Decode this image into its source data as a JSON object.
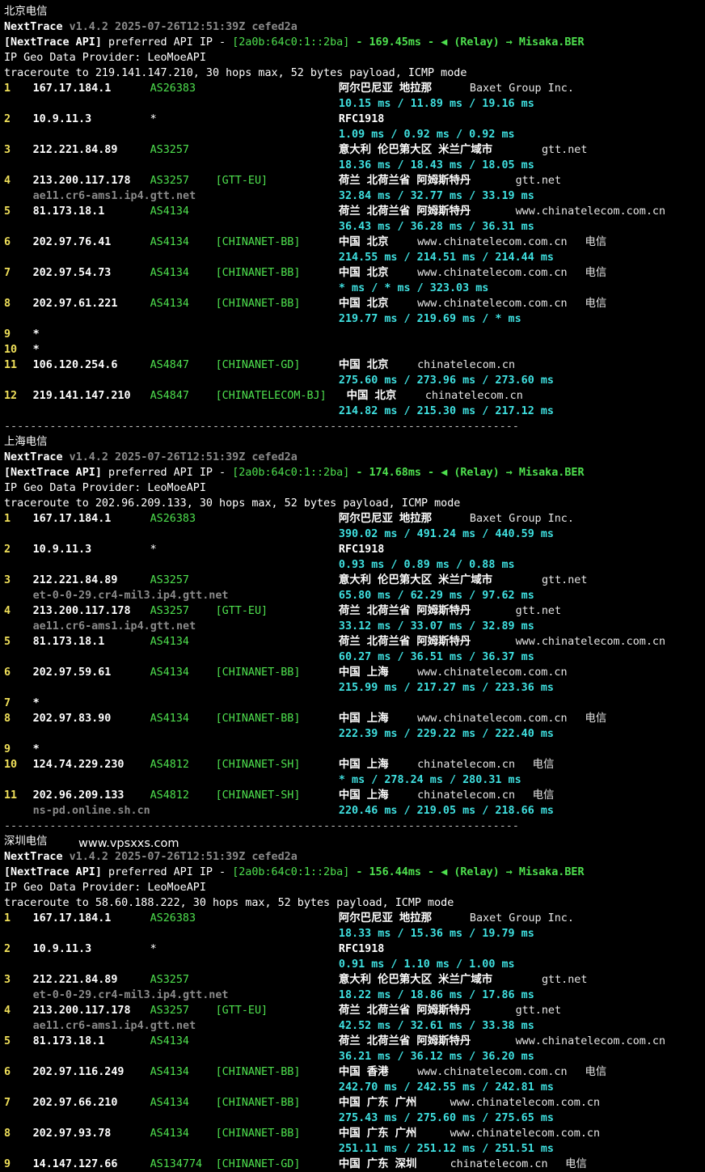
{
  "colors": {
    "background": "#000000",
    "ip": "#ffffff",
    "asn": "#4ee04e",
    "latency": "#3fe0e0",
    "hop": "#f0e05a",
    "rdns": "#8a8a8a"
  },
  "watermark": "www.vpsxxs.com",
  "separator": "-------------------------------------------------------------------------------",
  "sections": [
    {
      "title": "北京电信",
      "version_name": "NextTrace",
      "version": "v1.4.2 2025-07-26T12:51:39Z cefed2a",
      "api_prefix": "[NextTrace API]",
      "api_mid": " preferred API IP - ",
      "api_ip": "[2a0b:64c0:1::2ba]",
      "api_rest": " - 169.45ms - ",
      "api_relay": "(Relay) → Misaka.BER",
      "geo_provider": "IP Geo Data Provider: LeoMoeAPI",
      "traceroute": "traceroute to 219.141.147.210, 30 hops max, 52 bytes payload, ICMP mode",
      "hops": [
        {
          "n": "1",
          "ip": "167.17.184.1",
          "asn": "AS26383",
          "tag": "",
          "geo": "阿尔巴尼亚 地拉那",
          "org": "Baxet Group Inc.",
          "isp": "",
          "lat": "10.15 ms / 11.89 ms / 19.16 ms",
          "rdns": ""
        },
        {
          "n": "2",
          "ip": "10.9.11.3",
          "asn": "*",
          "tag": "",
          "geo": "RFC1918",
          "org": "",
          "isp": "",
          "lat": "1.09 ms / 0.92 ms / 0.92 ms",
          "rdns": ""
        },
        {
          "n": "3",
          "ip": "212.221.84.89",
          "asn": "AS3257",
          "tag": "",
          "geo": "意大利 伦巴第大区 米兰广域市",
          "org": "gtt.net",
          "isp": "",
          "lat": "18.36 ms / 18.43 ms / 18.05 ms",
          "rdns": ""
        },
        {
          "n": "4",
          "ip": "213.200.117.178",
          "asn": "AS3257",
          "tag": "[GTT-EU]",
          "geo": "荷兰 北荷兰省 阿姆斯特丹",
          "org": "gtt.net",
          "isp": "",
          "lat": "32.84 ms / 32.77 ms / 33.19 ms",
          "rdns": "ae11.cr6-ams1.ip4.gtt.net"
        },
        {
          "n": "5",
          "ip": "81.173.18.1",
          "asn": "AS4134",
          "tag": "",
          "geo": "荷兰 北荷兰省 阿姆斯特丹",
          "org": "www.chinatelecom.com.cn",
          "isp": "",
          "lat": "36.43 ms / 36.28 ms / 36.31 ms",
          "rdns": ""
        },
        {
          "n": "6",
          "ip": "202.97.76.41",
          "asn": "AS4134",
          "tag": "[CHINANET-BB]",
          "geo": "中国 北京",
          "org": "www.chinatelecom.com.cn",
          "isp": "电信",
          "lat": "214.55 ms / 214.51 ms / 214.44 ms",
          "rdns": ""
        },
        {
          "n": "7",
          "ip": "202.97.54.73",
          "asn": "AS4134",
          "tag": "[CHINANET-BB]",
          "geo": "中国 北京",
          "org": "www.chinatelecom.com.cn",
          "isp": "电信",
          "lat": "* ms / * ms / 323.03 ms",
          "rdns": ""
        },
        {
          "n": "8",
          "ip": "202.97.61.221",
          "asn": "AS4134",
          "tag": "[CHINANET-BB]",
          "geo": "中国 北京",
          "org": "www.chinatelecom.com.cn",
          "isp": "电信",
          "lat": "219.77 ms / 219.69 ms / * ms",
          "rdns": ""
        },
        {
          "n": "9",
          "ip": "*",
          "asn": "",
          "tag": "",
          "geo": "",
          "org": "",
          "isp": "",
          "lat": "",
          "rdns": ""
        },
        {
          "n": "10",
          "ip": "*",
          "asn": "",
          "tag": "",
          "geo": "",
          "org": "",
          "isp": "",
          "lat": "",
          "rdns": ""
        },
        {
          "n": "11",
          "ip": "106.120.254.6",
          "asn": "AS4847",
          "tag": "[CHINANET-GD]",
          "geo": "中国 北京",
          "org": "chinatelecom.cn",
          "isp": "",
          "lat": "275.60 ms / 273.96 ms / 273.60 ms",
          "rdns": ""
        },
        {
          "n": "12",
          "ip": "219.141.147.210",
          "asn": "AS4847",
          "tag": "[CHINATELECOM-BJ]",
          "geo": "中国 北京",
          "org": "chinatelecom.cn",
          "isp": "",
          "lat": "214.82 ms / 215.30 ms / 217.12 ms",
          "rdns": ""
        }
      ]
    },
    {
      "title": "上海电信",
      "version_name": "NextTrace",
      "version": "v1.4.2 2025-07-26T12:51:39Z cefed2a",
      "api_prefix": "[NextTrace API]",
      "api_mid": " preferred API IP - ",
      "api_ip": "[2a0b:64c0:1::2ba]",
      "api_rest": " - 174.68ms - ",
      "api_relay": "(Relay) → Misaka.BER",
      "geo_provider": "IP Geo Data Provider: LeoMoeAPI",
      "traceroute": "traceroute to 202.96.209.133, 30 hops max, 52 bytes payload, ICMP mode",
      "hops": [
        {
          "n": "1",
          "ip": "167.17.184.1",
          "asn": "AS26383",
          "tag": "",
          "geo": "阿尔巴尼亚 地拉那",
          "org": "Baxet Group Inc.",
          "isp": "",
          "lat": "390.02 ms / 491.24 ms / 440.59 ms",
          "rdns": ""
        },
        {
          "n": "2",
          "ip": "10.9.11.3",
          "asn": "*",
          "tag": "",
          "geo": "RFC1918",
          "org": "",
          "isp": "",
          "lat": "0.93 ms / 0.89 ms / 0.88 ms",
          "rdns": ""
        },
        {
          "n": "3",
          "ip": "212.221.84.89",
          "asn": "AS3257",
          "tag": "",
          "geo": "意大利 伦巴第大区 米兰广域市",
          "org": "gtt.net",
          "isp": "",
          "lat": "65.80 ms / 62.29 ms / 97.62 ms",
          "rdns": "et-0-0-29.cr4-mil3.ip4.gtt.net"
        },
        {
          "n": "4",
          "ip": "213.200.117.178",
          "asn": "AS3257",
          "tag": "[GTT-EU]",
          "geo": "荷兰 北荷兰省 阿姆斯特丹",
          "org": "gtt.net",
          "isp": "",
          "lat": "33.12 ms / 33.07 ms / 32.89 ms",
          "rdns": "ae11.cr6-ams1.ip4.gtt.net"
        },
        {
          "n": "5",
          "ip": "81.173.18.1",
          "asn": "AS4134",
          "tag": "",
          "geo": "荷兰 北荷兰省 阿姆斯特丹",
          "org": "www.chinatelecom.com.cn",
          "isp": "",
          "lat": "60.27 ms / 36.51 ms / 36.37 ms",
          "rdns": ""
        },
        {
          "n": "6",
          "ip": "202.97.59.61",
          "asn": "AS4134",
          "tag": "[CHINANET-BB]",
          "geo": "中国 上海",
          "org": "www.chinatelecom.com.cn",
          "isp": "",
          "lat": "215.99 ms / 217.27 ms / 223.36 ms",
          "rdns": ""
        },
        {
          "n": "7",
          "ip": "*",
          "asn": "",
          "tag": "",
          "geo": "",
          "org": "",
          "isp": "",
          "lat": "",
          "rdns": ""
        },
        {
          "n": "8",
          "ip": "202.97.83.90",
          "asn": "AS4134",
          "tag": "[CHINANET-BB]",
          "geo": "中国 上海",
          "org": "www.chinatelecom.com.cn",
          "isp": "电信",
          "lat": "222.39 ms / 229.22 ms / 222.40 ms",
          "rdns": ""
        },
        {
          "n": "9",
          "ip": "*",
          "asn": "",
          "tag": "",
          "geo": "",
          "org": "",
          "isp": "",
          "lat": "",
          "rdns": ""
        },
        {
          "n": "10",
          "ip": "124.74.229.230",
          "asn": "AS4812",
          "tag": "[CHINANET-SH]",
          "geo": "中国 上海",
          "org": "chinatelecom.cn",
          "isp": "电信",
          "lat": "* ms / 278.24 ms / 280.31 ms",
          "rdns": ""
        },
        {
          "n": "11",
          "ip": "202.96.209.133",
          "asn": "AS4812",
          "tag": "[CHINANET-SH]",
          "geo": "中国 上海",
          "org": "chinatelecom.cn",
          "isp": "电信",
          "lat": "220.46 ms / 219.05 ms / 218.66 ms",
          "rdns": "ns-pd.online.sh.cn"
        }
      ]
    },
    {
      "title": "深圳电信",
      "version_name": "NextTrace",
      "version": "v1.4.2 2025-07-26T12:51:39Z cefed2a",
      "api_prefix": "[NextTrace API]",
      "api_mid": " preferred API IP - ",
      "api_ip": "[2a0b:64c0:1::2ba]",
      "api_rest": " - 156.44ms - ",
      "api_relay": "(Relay) → Misaka.BER",
      "geo_provider": "IP Geo Data Provider: LeoMoeAPI",
      "traceroute": "traceroute to 58.60.188.222, 30 hops max, 52 bytes payload, ICMP mode",
      "hops": [
        {
          "n": "1",
          "ip": "167.17.184.1",
          "asn": "AS26383",
          "tag": "",
          "geo": "阿尔巴尼亚 地拉那",
          "org": "Baxet Group Inc.",
          "isp": "",
          "lat": "18.33 ms / 15.36 ms / 19.79 ms",
          "rdns": ""
        },
        {
          "n": "2",
          "ip": "10.9.11.3",
          "asn": "*",
          "tag": "",
          "geo": "RFC1918",
          "org": "",
          "isp": "",
          "lat": "0.91 ms / 1.10 ms / 1.00 ms",
          "rdns": ""
        },
        {
          "n": "3",
          "ip": "212.221.84.89",
          "asn": "AS3257",
          "tag": "",
          "geo": "意大利 伦巴第大区 米兰广域市",
          "org": "gtt.net",
          "isp": "",
          "lat": "18.22 ms / 18.86 ms / 17.86 ms",
          "rdns": "et-0-0-29.cr4-mil3.ip4.gtt.net"
        },
        {
          "n": "4",
          "ip": "213.200.117.178",
          "asn": "AS3257",
          "tag": "[GTT-EU]",
          "geo": "荷兰 北荷兰省 阿姆斯特丹",
          "org": "gtt.net",
          "isp": "",
          "lat": "42.52 ms / 32.61 ms / 33.38 ms",
          "rdns": "ae11.cr6-ams1.ip4.gtt.net"
        },
        {
          "n": "5",
          "ip": "81.173.18.1",
          "asn": "AS4134",
          "tag": "",
          "geo": "荷兰 北荷兰省 阿姆斯特丹",
          "org": "www.chinatelecom.com.cn",
          "isp": "",
          "lat": "36.21 ms / 36.12 ms / 36.20 ms",
          "rdns": ""
        },
        {
          "n": "6",
          "ip": "202.97.116.249",
          "asn": "AS4134",
          "tag": "[CHINANET-BB]",
          "geo": "中国 香港",
          "org": "www.chinatelecom.com.cn",
          "isp": "电信",
          "lat": "242.70 ms / 242.55 ms / 242.81 ms",
          "rdns": ""
        },
        {
          "n": "7",
          "ip": "202.97.66.210",
          "asn": "AS4134",
          "tag": "[CHINANET-BB]",
          "geo": "中国 广东 广州",
          "org": "www.chinatelecom.com.cn",
          "isp": "",
          "lat": "275.43 ms / 275.60 ms / 275.65 ms",
          "rdns": ""
        },
        {
          "n": "8",
          "ip": "202.97.93.78",
          "asn": "AS4134",
          "tag": "[CHINANET-BB]",
          "geo": "中国 广东 广州",
          "org": "www.chinatelecom.com.cn",
          "isp": "",
          "lat": "251.11 ms / 251.12 ms / 251.51 ms",
          "rdns": ""
        },
        {
          "n": "9",
          "ip": "14.147.127.66",
          "asn": "AS134774",
          "tag": "[CHINANET-GD]",
          "geo": "中国 广东 深圳",
          "org": "chinatelecom.cn",
          "isp": "电信",
          "lat": "",
          "rdns": ""
        }
      ]
    }
  ]
}
